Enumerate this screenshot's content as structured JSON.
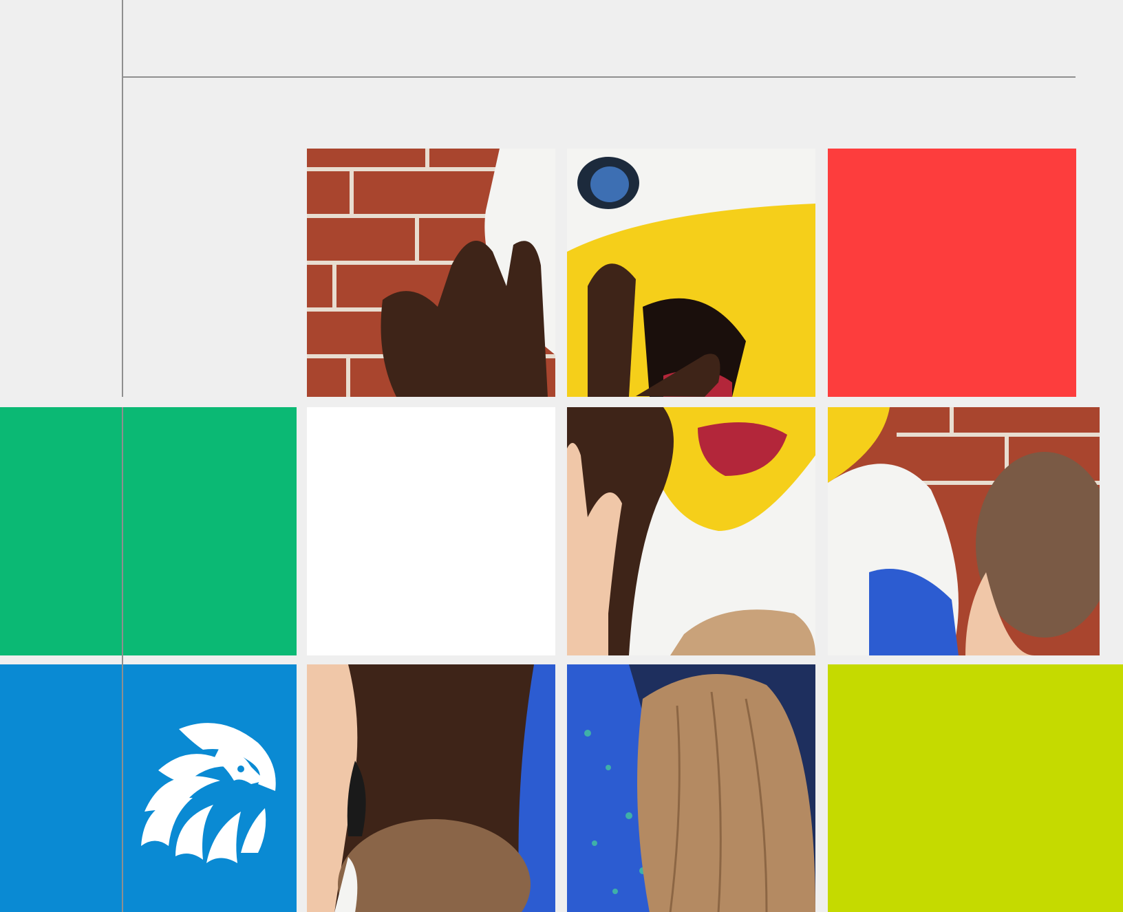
{
  "page": {
    "background_color": "#efefef",
    "guide_line_color": "#8f8f8f"
  },
  "tiles": {
    "green": {
      "color": "#0bb974"
    },
    "white": {
      "color": "#ffffff"
    },
    "red": {
      "color": "#fd3d3d"
    },
    "blue": {
      "color": "#0a8ad3"
    },
    "lime": {
      "color": "#c5da00"
    }
  },
  "photo": {
    "subject_icon": "eagle-mascot-high-five-photo",
    "palette": {
      "brick": "#a9452e",
      "mortar": "#e8ddd0",
      "feather_white": "#f4f4f2",
      "beak_yellow": "#f5cf1a",
      "glove_brown": "#3e2418",
      "mouth_red": "#b3263a",
      "hair_brown": "#7a5a45",
      "hair_blonde": "#b48a62",
      "skin": "#f0c7a8",
      "sleeve_blue": "#2c5cd1",
      "eye_blue": "#3d6fb3"
    }
  },
  "logo": {
    "icon": "eagle-head-logo-icon",
    "color": "#ffffff"
  }
}
